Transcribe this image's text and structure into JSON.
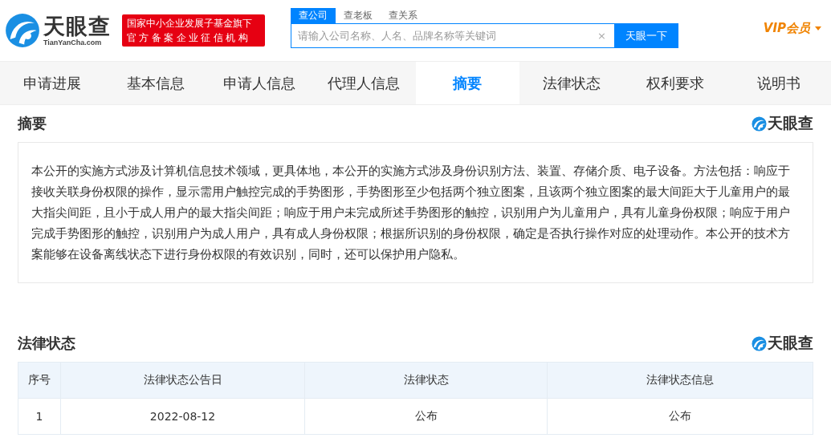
{
  "header": {
    "logo_text": "天眼查",
    "logo_domain": "TianYanCha.com",
    "badge_lines": [
      "国家中小企业发展子基金旗下",
      "官方备案企业征信机构"
    ],
    "search_tabs": [
      {
        "label": "查公司",
        "selected": true
      },
      {
        "label": "查老板",
        "selected": false
      },
      {
        "label": "查关系",
        "selected": false
      }
    ],
    "search": {
      "placeholder": "请输入公司名称、人名、品牌名称等关键词",
      "clear": "×",
      "button": "天眼一下"
    },
    "vip": "VIP会员"
  },
  "tabs": [
    {
      "label": "申请进展",
      "selected": false
    },
    {
      "label": "基本信息",
      "selected": false
    },
    {
      "label": "申请人信息",
      "selected": false
    },
    {
      "label": "代理人信息",
      "selected": false
    },
    {
      "label": "摘要",
      "selected": true
    },
    {
      "label": "法律状态",
      "selected": false
    },
    {
      "label": "权利要求",
      "selected": false
    },
    {
      "label": "说明书",
      "selected": false
    }
  ],
  "abstract": {
    "title": "摘要",
    "brand": "天眼查",
    "text": "本公开的实施方式涉及计算机信息技术领域，更具体地，本公开的实施方式涉及身份识别方法、装置、存储介质、电子设备。方法包括：响应于接收关联身份权限的操作，显示需用户触控完成的手势图形，手势图形至少包括两个独立图案，且该两个独立图案的最大间距大于儿童用户的最大指尖间距，且小于成人用户的最大指尖间距；响应于用户未完成所述手势图形的触控，识别用户为儿童用户，具有儿童身份权限；响应于用户完成手势图形的触控，识别用户为成人用户，具有成人身份权限；根据所识别的身份权限，确定是否执行操作对应的处理动作。本公开的技术方案能够在设备离线状态下进行身份权限的有效识别，同时，还可以保护用户隐私。"
  },
  "legal_status": {
    "title": "法律状态",
    "brand": "天眼查",
    "table": {
      "columns": [
        "序号",
        "法律状态公告日",
        "法律状态",
        "法律状态信息"
      ],
      "rows": [
        [
          "1",
          "2022-08-12",
          "公布",
          "公布"
        ]
      ]
    }
  }
}
